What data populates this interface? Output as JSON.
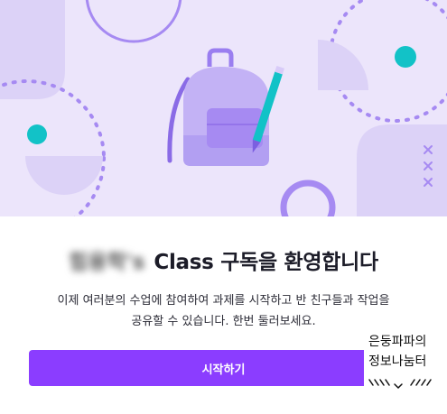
{
  "welcome_modal": {
    "blurred_name": "힘용학's",
    "title": "Class 구독을 환영합니다",
    "subtitle_line1": "이제 여러분의 수업에 참여하여 과제를 시작하고 반 친구들과 작업을",
    "subtitle_line2": "공유할 수 있습니다. 한번 둘러보세요.",
    "start_button_label": "시작하기"
  },
  "illustration": {
    "background_color": "#ece5fb",
    "shape_color": "#dcd2f7",
    "accent_purple": "#a68af2",
    "accent_teal": "#12c2c7",
    "icon": "backpack-with-pencil"
  },
  "watermark": {
    "line1": "은둥파파의",
    "line2": "정보나눔터"
  },
  "colors": {
    "primary_button": "#8b3dff",
    "title_text": "#1c1c28"
  }
}
